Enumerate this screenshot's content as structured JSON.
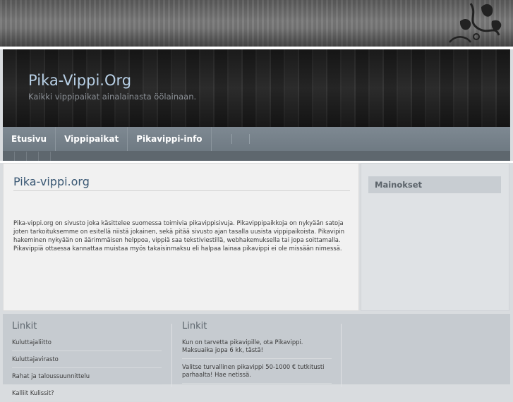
{
  "site": {
    "title": "Pika-Vippi.Org",
    "tagline": "Kaikki vippipaikat ainalainasta öölainaan."
  },
  "nav": {
    "items": [
      {
        "label": "Etusivu"
      },
      {
        "label": "Vippipaikat"
      },
      {
        "label": "Pikavippi-info"
      }
    ]
  },
  "main": {
    "title": "Pika-vippi.org",
    "body": "Pika-vippi.org on sivusto joka käsittelee suomessa toimivia pikavippisivuja. Pikavippipaikkoja on nykyään satoja joten tarkoituksemme on esitellä niistä jokainen, sekä pitää sivusto ajan tasalla uusista vippipaikoista. Pikavipin hakeminen nykyään on äärimmäisen helppoa, vippiä saa tekstiviestillä, webhakemuksella tai jopa soittamalla. Pikavippiä ottaessa kannattaa muistaa myös takaisinmaksu eli halpaa lainaa pikavippi ei ole missään nimessä."
  },
  "sidebar": {
    "ads_title": "Mainokset"
  },
  "footer": {
    "col1": {
      "title": "Linkit",
      "links": [
        "Kuluttajaliitto",
        "Kuluttajavirasto",
        "Rahat ja taloussuunnittelu",
        "Kalliit Kulissit?"
      ]
    },
    "col2": {
      "title": "Linkit",
      "links": [
        "Kun on tarvetta pikavipille, ota Pikavippi. Maksuaika jopa 6 kk, tästä!",
        "Valitse turvallinen pikavippi 50-1000 € tutkitusti parhaalta! Hae netissä."
      ]
    }
  }
}
